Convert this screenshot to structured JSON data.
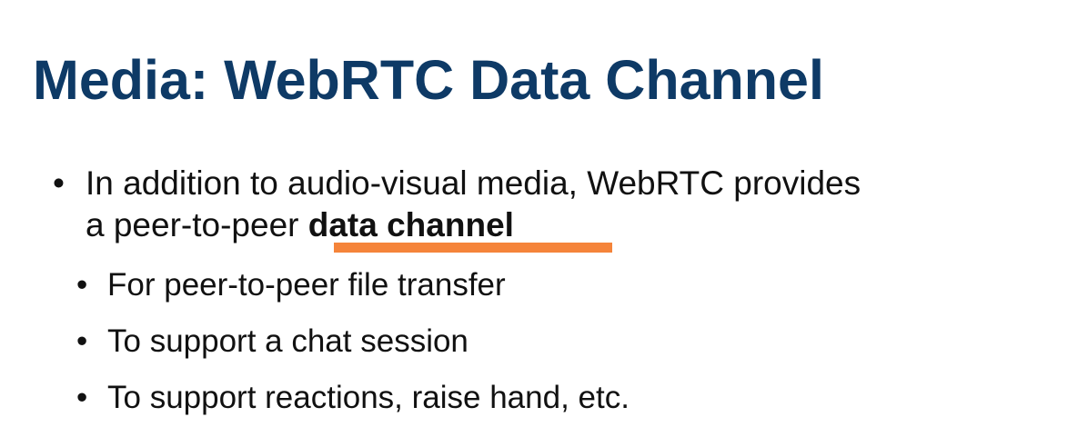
{
  "slide": {
    "title": "Media: WebRTC Data Channel",
    "bullet": {
      "marker": "•",
      "line1": "In addition to audio-visual media, WebRTC provides",
      "line2_prefix": "a peer-to-peer ",
      "line2_emphasis": "data channel"
    },
    "sub_bullets": [
      {
        "marker": "•",
        "text": "For peer-to-peer file transfer"
      },
      {
        "marker": "•",
        "text": "To support a chat session"
      },
      {
        "marker": "•",
        "text": "To support reactions, raise hand, etc."
      }
    ],
    "colors": {
      "title": "#0e3a66",
      "highlight_underline": "#f5843a",
      "text": "#111111"
    }
  }
}
